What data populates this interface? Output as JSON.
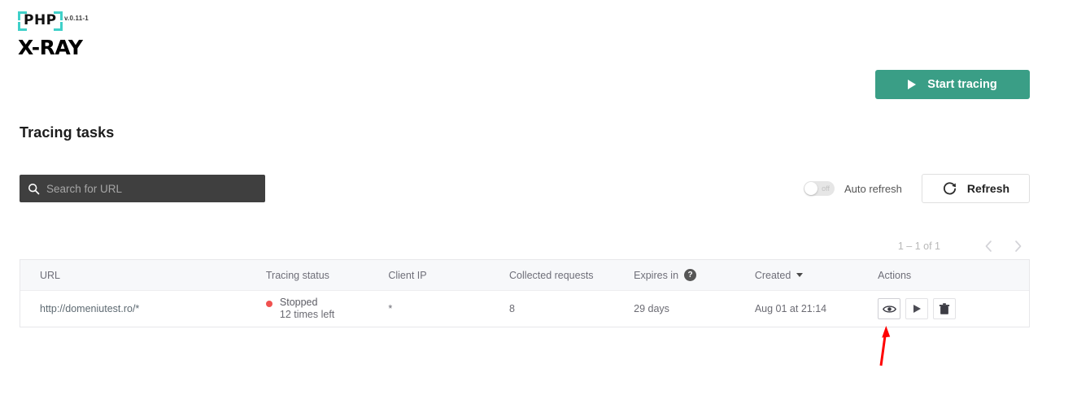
{
  "logo": {
    "mark_text": "PHP",
    "version": "v.0.11-1",
    "name": "X-RAY",
    "bracket_color": "#3fd0c9"
  },
  "toolbar": {
    "start_tracing_label": "Start tracing",
    "start_tracing_color": "#3a9e86"
  },
  "page": {
    "title": "Tracing tasks"
  },
  "search": {
    "value": "",
    "placeholder": "Search for URL"
  },
  "auto_refresh": {
    "state_label": "off",
    "label": "Auto refresh",
    "enabled": false
  },
  "refresh": {
    "label": "Refresh"
  },
  "pagination": {
    "range_label": "1 – 1 of 1",
    "prev_icon": "chevron-left-icon",
    "next_icon": "chevron-right-icon"
  },
  "table": {
    "columns": [
      {
        "label": "URL"
      },
      {
        "label": "Tracing status"
      },
      {
        "label": "Client IP"
      },
      {
        "label": "Collected requests"
      },
      {
        "label": "Expires in",
        "help": "?"
      },
      {
        "label": "Created",
        "sorted": "desc"
      },
      {
        "label": "Actions"
      }
    ],
    "rows": [
      {
        "url": "http://domeniutest.ro/*",
        "status": "Stopped",
        "status_sub": "12 times left",
        "status_color": "#f0514f",
        "client_ip": "*",
        "collected_requests": "8",
        "expires_in": "29 days",
        "created": "Aug 01 at 21:14",
        "actions": [
          "view-icon",
          "play-icon",
          "delete-icon"
        ]
      }
    ]
  },
  "annotation": {
    "type": "arrow",
    "color": "#ff0000",
    "points_at": "view-action-button"
  }
}
